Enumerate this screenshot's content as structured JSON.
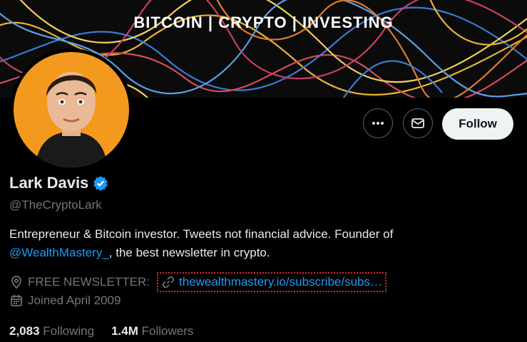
{
  "banner": {
    "text": "BITCOIN | CRYPTO | INVESTING"
  },
  "profile": {
    "name": "Lark Davis",
    "handle": "@TheCryptoLark",
    "bio_text_1": "Entrepreneur & Bitcoin investor. Tweets not financial advice. Founder of",
    "bio_mention": "@WealthMastery_",
    "bio_text_2": ", the best newsletter in crypto.",
    "location": "FREE NEWSLETTER:",
    "url": "thewealthmastery.io/subscribe/subs…",
    "joined": "Joined April 2009"
  },
  "actions": {
    "follow_label": "Follow"
  },
  "stats": {
    "following_count": "2,083",
    "following_label": "Following",
    "followers_count": "1.4M",
    "followers_label": "Followers"
  },
  "colors": {
    "accent": "#1d9bf0",
    "avatar_bg": "#f39a1e",
    "verified": "#1d9bf0"
  }
}
